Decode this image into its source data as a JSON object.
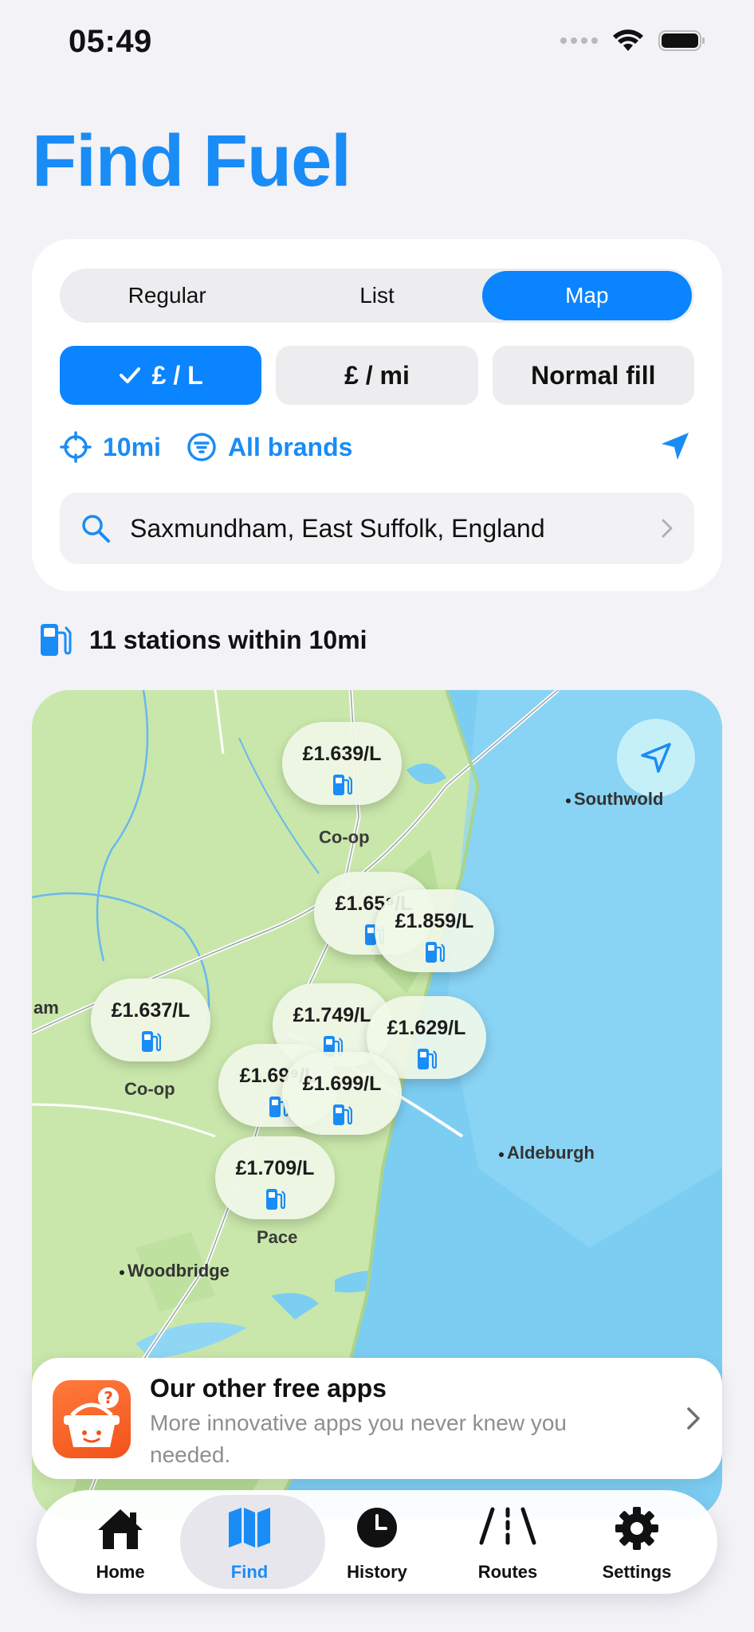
{
  "status_bar": {
    "time": "05:49"
  },
  "page_title": "Find Fuel",
  "view_mode": {
    "options": [
      "Regular",
      "List",
      "Map"
    ],
    "selected": "Map"
  },
  "metric": {
    "price_per_litre": {
      "label": "£ / L",
      "selected": true
    },
    "price_per_mile": {
      "label": "£ / mi",
      "selected": false
    },
    "fill": {
      "label": "Normal fill",
      "selected": false
    }
  },
  "filters": {
    "radius": "10mi",
    "brands": "All brands"
  },
  "search": {
    "location": "Saxmundham, East Suffolk, England"
  },
  "summary": {
    "station_count_text": "11 stations within 10mi"
  },
  "map": {
    "towns": [
      "Southwold",
      "Aldeburgh",
      "Woodbridge",
      "am"
    ],
    "stations": [
      {
        "price": "£1.639/L",
        "brand": "Co-op"
      },
      {
        "price": "£1.65⁹/L",
        "brand": ""
      },
      {
        "price": "£1.859/L",
        "brand": ""
      },
      {
        "price": "£1.637/L",
        "brand": "Co-op"
      },
      {
        "price": "£1.749/L",
        "brand": ""
      },
      {
        "price": "£1.629/L",
        "brand": ""
      },
      {
        "price": "£1.69⁹/L",
        "brand": ""
      },
      {
        "price": "£1.699/L",
        "brand": ""
      },
      {
        "price": "£1.709/L",
        "brand": "Pace"
      }
    ]
  },
  "promo": {
    "title": "Our other free apps",
    "subtitle": "More innovative apps you never knew you needed."
  },
  "tab_bar": {
    "tabs": [
      {
        "label": "Home",
        "icon": "house-icon"
      },
      {
        "label": "Find",
        "icon": "map-icon"
      },
      {
        "label": "History",
        "icon": "clock-icon"
      },
      {
        "label": "Routes",
        "icon": "road-icon"
      },
      {
        "label": "Settings",
        "icon": "gear-icon"
      }
    ],
    "selected": "Find"
  },
  "colors": {
    "accent": "#0a84ff",
    "title_blue": "#1a8cf5",
    "background": "#f2f2f7"
  }
}
